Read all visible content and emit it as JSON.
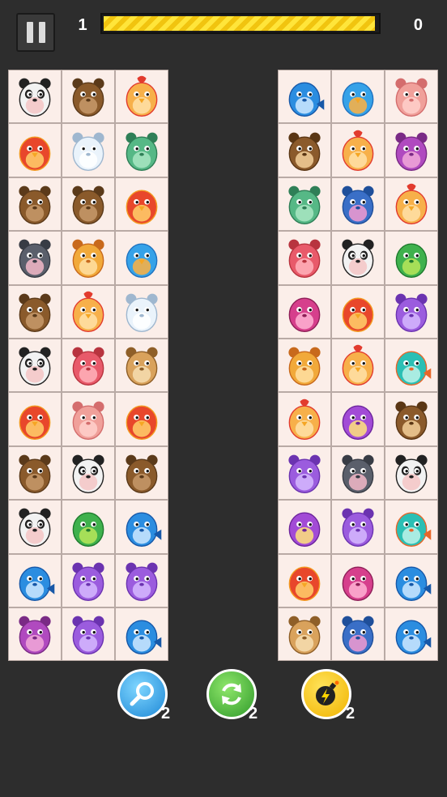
{
  "hud": {
    "level": "1",
    "score": "0",
    "timer_progress": 0.99
  },
  "colors": {
    "background": "#2d2d2d",
    "tile": "#fbeee9",
    "timer_fill": "#ffe53a"
  },
  "boards": {
    "left": [
      [
        "panda",
        "bear",
        "chicken"
      ],
      [
        "bird-red",
        "sheep",
        "hippo-green"
      ],
      [
        "bear",
        "bear",
        "bird-red"
      ],
      [
        "mouse",
        "lion",
        "bird-blue"
      ],
      [
        "bear",
        "chicken",
        "sheep"
      ],
      [
        "panda",
        "pig-red",
        "tiger"
      ],
      [
        "bird-red",
        "pig",
        "bird-red"
      ],
      [
        "bear",
        "panda",
        "bear"
      ],
      [
        "panda",
        "dino",
        "fish-blue"
      ],
      [
        "fish-blue",
        "bunny",
        "bunny"
      ],
      [
        "cat-purple",
        "bunny",
        "fish-blue"
      ]
    ],
    "right": [
      [
        "fish-blue",
        "bird-blue",
        "pig"
      ],
      [
        "monkey",
        "chicken",
        "cat-purple"
      ],
      [
        "hippo-green",
        "hippo-blue",
        "chicken"
      ],
      [
        "pig-red",
        "panda",
        "dino"
      ],
      [
        "flamingo",
        "bird-red",
        "bunny"
      ],
      [
        "lion",
        "chicken",
        "fish-teal"
      ],
      [
        "chicken",
        "octopus",
        "monkey"
      ],
      [
        "bunny",
        "mouse",
        "panda"
      ],
      [
        "octopus",
        "bunny",
        "fish-teal"
      ],
      [
        "bird-red",
        "flamingo",
        "fish-blue"
      ],
      [
        "tiger",
        "hippo-blue",
        "fish-blue"
      ]
    ]
  },
  "boosters": [
    {
      "name": "hint",
      "icon": "magnifier-icon",
      "count": "2"
    },
    {
      "name": "shuffle",
      "icon": "shuffle-icon",
      "count": "2"
    },
    {
      "name": "bomb",
      "icon": "bomb-icon",
      "count": "2"
    }
  ]
}
